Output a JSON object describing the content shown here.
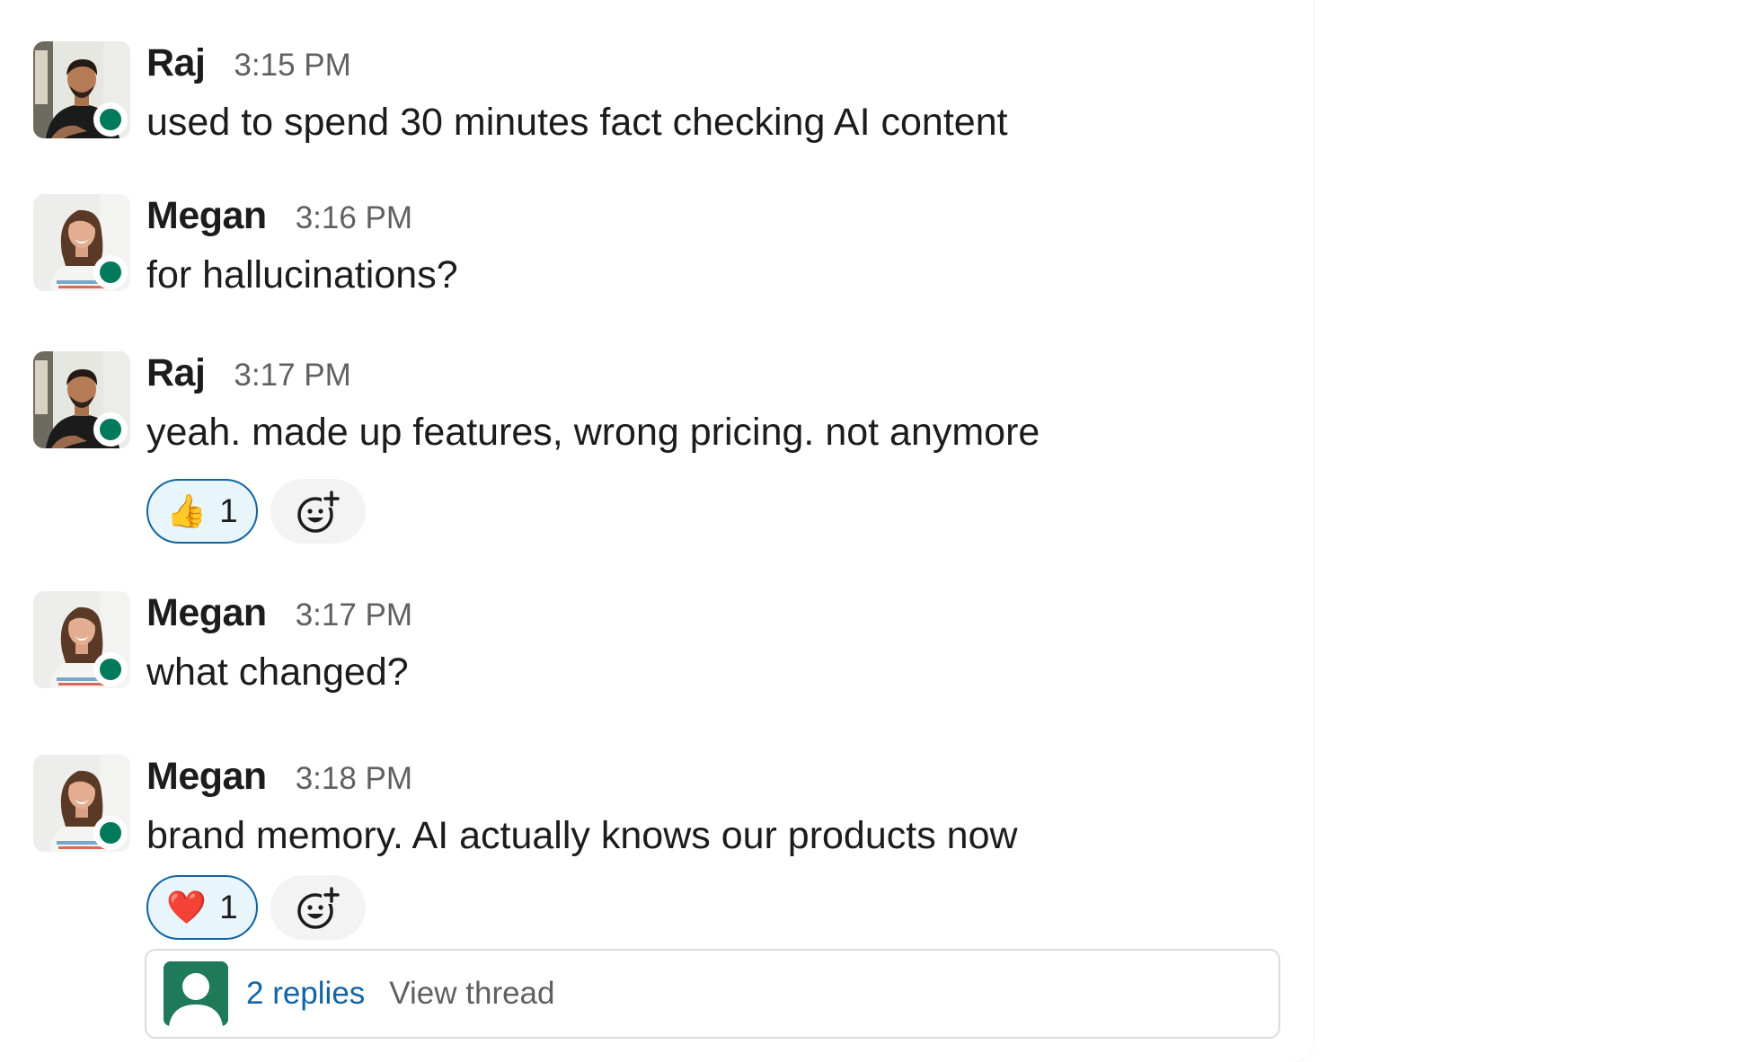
{
  "messages": [
    {
      "author": "Raj",
      "time": "3:15 PM",
      "text": "used to spend 30 minutes fact checking AI content",
      "avatar": "raj-avatar",
      "status": "online"
    },
    {
      "author": "Megan",
      "time": "3:16 PM",
      "text": "for hallucinations?",
      "avatar": "megan-avatar",
      "status": "online"
    },
    {
      "author": "Raj",
      "time": "3:17 PM",
      "text": "yeah. made up features, wrong pricing. not anymore",
      "avatar": "raj-avatar",
      "status": "online",
      "reactions": [
        {
          "emoji": "👍",
          "icon": "thumbs-up-icon",
          "count": "1"
        }
      ]
    },
    {
      "author": "Megan",
      "time": "3:17 PM",
      "text": "what changed?",
      "avatar": "megan-avatar",
      "status": "online"
    },
    {
      "author": "Megan",
      "time": "3:18 PM",
      "text": "brand memory. AI actually knows our products now",
      "avatar": "megan-avatar",
      "status": "online",
      "reactions": [
        {
          "emoji": "❤️",
          "icon": "heart-icon",
          "count": "1"
        }
      ],
      "thread": {
        "replies_label": "2 replies",
        "view_label": "View thread",
        "avatar_icon": "default-user-icon"
      }
    }
  ],
  "icons": {
    "add_reaction": "add-reaction-icon"
  },
  "colors": {
    "presence_online": "#007a5a",
    "link": "#1264a3",
    "reaction_border": "#1264a3",
    "reaction_bg": "#e8f5fa",
    "thread_avatar_bg": "#1f7a5a"
  }
}
